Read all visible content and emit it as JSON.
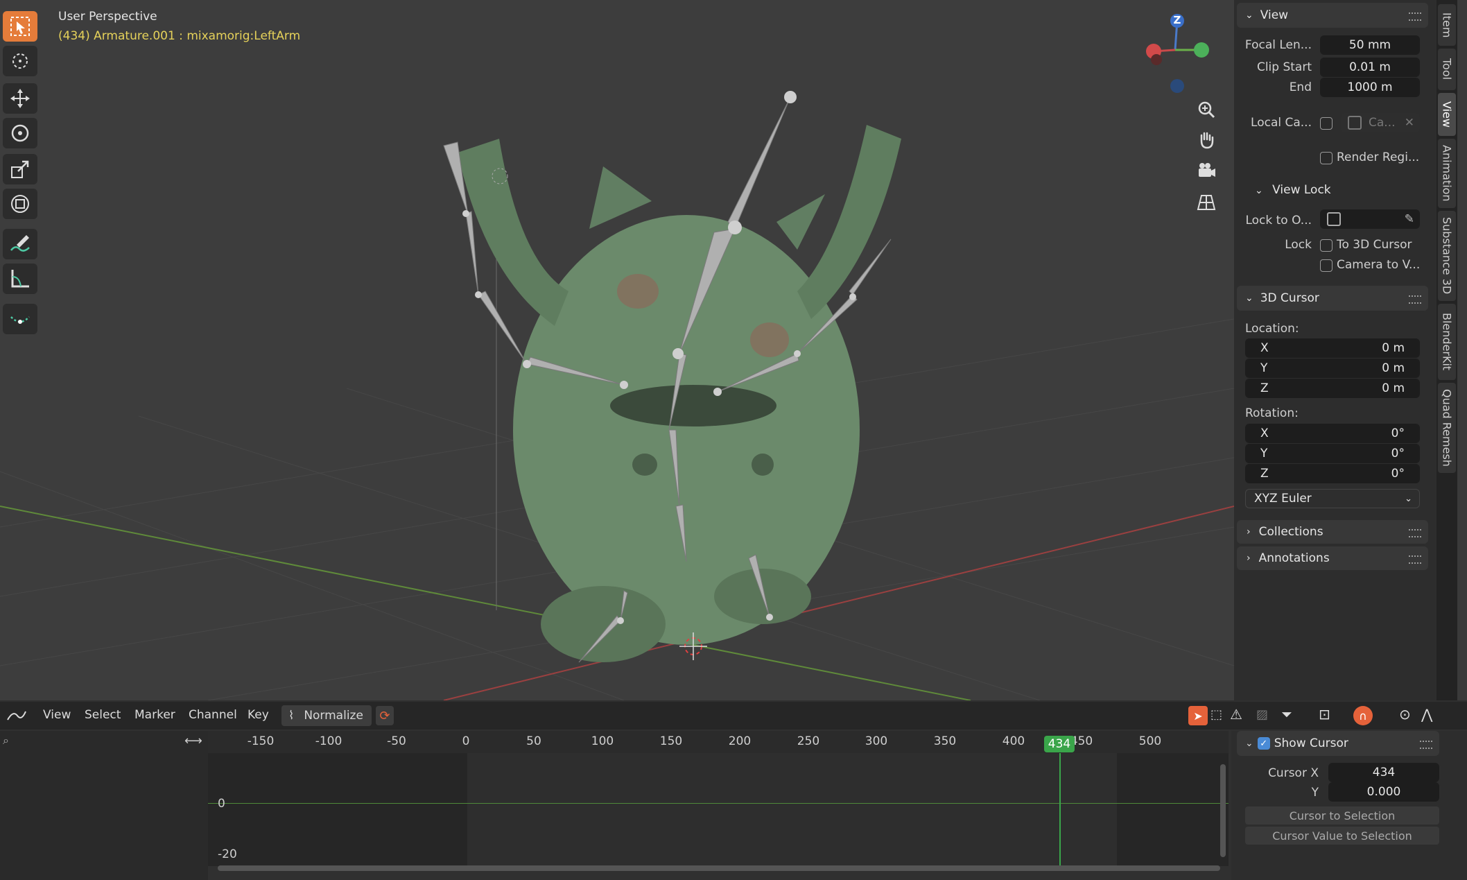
{
  "viewport": {
    "view_name": "User Perspective",
    "active_object": "(434) Armature.001 : mixamorig:LeftArm",
    "gizmo_axis_label": "Z"
  },
  "left_toolbar": {
    "tools": [
      "select-box-icon",
      "cursor-icon",
      "move-icon",
      "rotate-icon",
      "scale-icon",
      "transform-icon",
      "annotate-icon",
      "measure-icon",
      "add-bone-icon"
    ]
  },
  "nav_gizmo": [
    "zoom-icon",
    "hand-pan-icon",
    "camera-icon",
    "grid-perspective-icon"
  ],
  "sidebar_tabs": [
    "Item",
    "Tool",
    "View",
    "Animation",
    "Substance 3D",
    "BlenderKit",
    "Quad Remesh"
  ],
  "view_panel": {
    "title": "View",
    "focal_length_label": "Focal Len...",
    "focal_length_value": "50 mm",
    "clip_start_label": "Clip Start",
    "clip_start_value": "0.01 m",
    "clip_end_label": "End",
    "clip_end_value": "1000 m",
    "local_camera_label": "Local Ca...",
    "local_camera_value": "Ca...",
    "render_region_label": "Render Regi...",
    "view_lock_title": "View Lock",
    "lock_to_object_label": "Lock to O...",
    "lock_label": "Lock",
    "to_3d_cursor_label": "To 3D Cursor",
    "camera_to_view_label": "Camera to V..."
  },
  "cursor_panel": {
    "title": "3D Cursor",
    "location_label": "Location:",
    "loc_x": "0 m",
    "loc_y": "0 m",
    "loc_z": "0 m",
    "rotation_label": "Rotation:",
    "rot_x": "0°",
    "rot_y": "0°",
    "rot_z": "0°",
    "axis_x": "X",
    "axis_y": "Y",
    "axis_z": "Z",
    "rotation_mode": "XYZ Euler"
  },
  "collapsed_panels": {
    "collections": "Collections",
    "annotations": "Annotations"
  },
  "graph_editor": {
    "menus": [
      "View",
      "Select",
      "Marker",
      "Channel",
      "Key"
    ],
    "normalize_label": "Normalize",
    "ruler_ticks": [
      "-150",
      "-100",
      "-50",
      "0",
      "50",
      "100",
      "150",
      "200",
      "250",
      "300",
      "350",
      "400",
      "450",
      "500"
    ],
    "current_frame": "434",
    "y_labels": [
      "0",
      "-20"
    ],
    "show_cursor_label": "Show Cursor",
    "cursor_x_label": "Cursor X",
    "cursor_x_value": "434",
    "cursor_y_label": "Y",
    "cursor_y_value": "0.000",
    "cursor_to_selection": "Cursor to Selection",
    "cursor_value_to_selection": "Cursor Value to Selection"
  },
  "colors": {
    "accent_orange": "#e57c3a",
    "active_text_yellow": "#e6d25a",
    "playhead_green": "#3aa54a",
    "x_axis": "#b84a4a",
    "y_axis": "#6a9a3a"
  }
}
